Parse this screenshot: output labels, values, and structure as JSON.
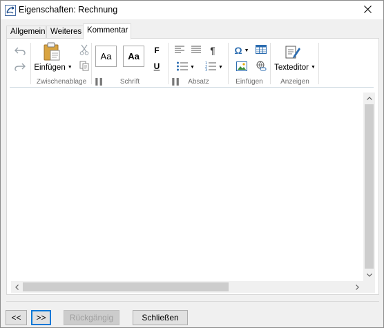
{
  "window": {
    "title": "Eigenschaften: Rechnung"
  },
  "tabs": [
    {
      "label": "Allgemein"
    },
    {
      "label": "Weiteres"
    },
    {
      "label": "Kommentar"
    }
  ],
  "ribbon": {
    "clipboard": {
      "paste_label": "Einfügen",
      "group_label": "Zwischenablage"
    },
    "font": {
      "style1": "Aa",
      "style2": "Aa",
      "bold": "F",
      "underline": "U",
      "group_label": "Schrift"
    },
    "paragraph": {
      "pilcrow": "¶",
      "group_label": "Absatz"
    },
    "insert": {
      "omega": "Ω",
      "group_label": "Einfügen"
    },
    "view": {
      "editor_label": "Texteditor",
      "group_label": "Anzeigen"
    }
  },
  "footer": {
    "prev_label": "<<",
    "next_label": ">>",
    "undo_label": "Rückgängig",
    "close_label": "Schließen"
  },
  "colors": {
    "focus": "#0078d7",
    "icon_blue": "#2b6cb0"
  }
}
